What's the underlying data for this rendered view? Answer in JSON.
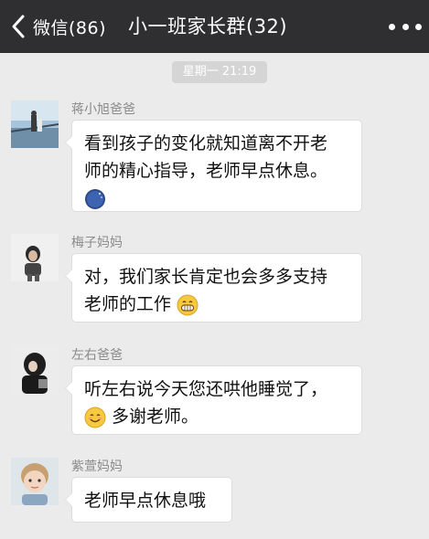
{
  "header": {
    "back_label": "微信(86)",
    "title": "小一班家长群(32)"
  },
  "timestamp": "星期一 21:19",
  "messages": [
    {
      "sender": "蒋小旭爸爸",
      "line1": "看到孩子的变化就知道离不开老",
      "line2": "师的精心指导，老师早点休息。",
      "emoji": "moon-emoji"
    },
    {
      "sender": "梅子妈妈",
      "line1": "对，我们家长肯定也会多多支持",
      "line2": "老师的工作",
      "emoji": "grinning-emoji"
    },
    {
      "sender": "左右爸爸",
      "line1": "听左右说今天您还哄他睡觉了，",
      "line2": "多谢老师。",
      "emoji": "smiling-emoji"
    },
    {
      "sender": "紫萱妈妈",
      "line1": "老师早点休息哦"
    }
  ],
  "colors": {
    "header_bg": "#2f2f31",
    "chat_bg": "#ebebeb",
    "bubble_bg": "#ffffff",
    "sender_text": "#8a8a8a"
  }
}
